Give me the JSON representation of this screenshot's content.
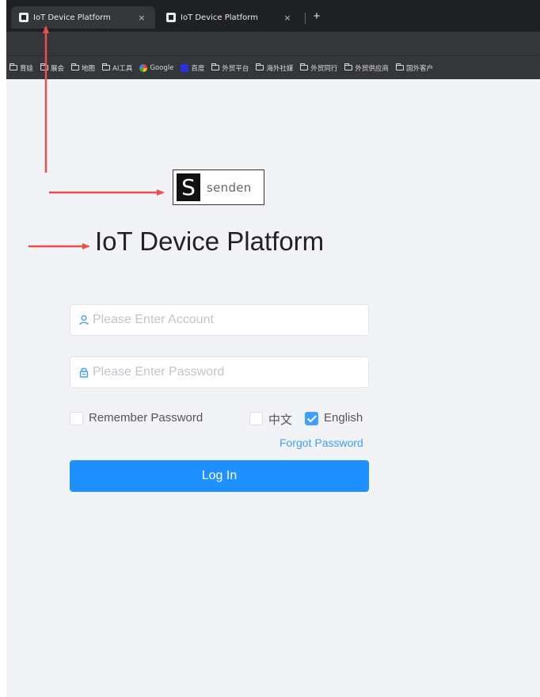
{
  "browser": {
    "tabs": [
      {
        "label": "IoT Device Platform",
        "active": true
      },
      {
        "label": "IoT Device Platform",
        "active": false
      }
    ],
    "close_glyph": "×",
    "new_tab_glyph": "+",
    "bookmarks": [
      {
        "label": "育娃",
        "icon": "folder-icon"
      },
      {
        "label": "展会",
        "icon": "folder-icon"
      },
      {
        "label": "地图",
        "icon": "folder-icon"
      },
      {
        "label": "AI工具",
        "icon": "folder-icon"
      },
      {
        "label": "Google",
        "icon": "google-icon"
      },
      {
        "label": "百度",
        "icon": "baidu-icon"
      },
      {
        "label": "外贸平台",
        "icon": "folder-icon"
      },
      {
        "label": "海外社媒",
        "icon": "folder-icon"
      },
      {
        "label": "外贸同行",
        "icon": "folder-icon"
      },
      {
        "label": "外贸供应商",
        "icon": "folder-icon"
      },
      {
        "label": "国外客户",
        "icon": "folder-icon"
      }
    ]
  },
  "logo": {
    "mark": "S",
    "wordmark": "senden"
  },
  "title": "IoT Device Platform",
  "form": {
    "account_placeholder": "Please Enter Account",
    "password_placeholder": "Please Enter Password",
    "remember_label": "Remember Password",
    "remember_checked": false,
    "lang_zh_label": "中文",
    "lang_zh_checked": false,
    "lang_en_label": "English",
    "lang_en_checked": true,
    "forgot_label": "Forgot Password",
    "login_label": "Log In"
  },
  "colors": {
    "accent": "#409eff",
    "login_button": "#1e90ff",
    "page_background": "#f2f3f6",
    "annotation_arrow": "#e8504a"
  }
}
